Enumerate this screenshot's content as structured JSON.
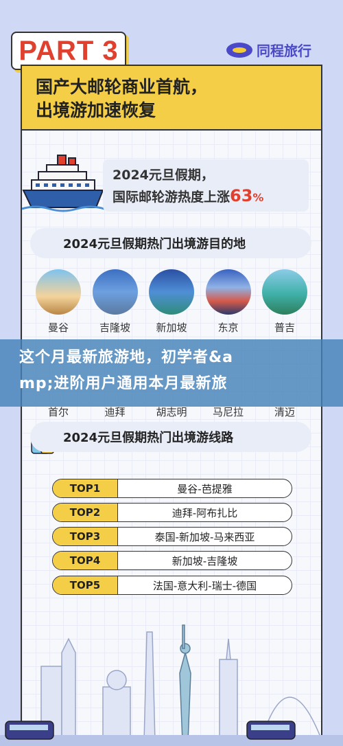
{
  "header": {
    "part_badge": "PART 3",
    "brand_name": "同程旅行",
    "title_line1": "国产大邮轮商业首航，",
    "title_line2": "出境游加速恢复"
  },
  "stat": {
    "line1": "2024元旦假期，",
    "line2_prefix": "国际邮轮游热度上涨",
    "percent_value": "63",
    "percent_sign": "%"
  },
  "destinations_section": {
    "title": "2024元旦假期热门出境游目的地",
    "row1": [
      "曼谷",
      "吉隆坡",
      "新加坡",
      "东京",
      "普吉"
    ],
    "row2": [
      "首尔",
      "迪拜",
      "胡志明",
      "马尼拉",
      "清迈"
    ]
  },
  "banner": {
    "line1": "这个月最新旅游地，初学者&a",
    "line2": "mp;进阶用户通用本月最新旅"
  },
  "routes_section": {
    "title": "2024元旦假期热门出境游线路",
    "routes": [
      {
        "rank": "TOP1",
        "route": "曼谷-芭提雅"
      },
      {
        "rank": "TOP2",
        "route": "迪拜-阿布扎比"
      },
      {
        "rank": "TOP3",
        "route": "泰国-新加坡-马来西亚"
      },
      {
        "rank": "TOP4",
        "route": "新加坡-吉隆坡"
      },
      {
        "rank": "TOP5",
        "route": "法国-意大利-瑞士-德国"
      }
    ]
  },
  "colors": {
    "accent_yellow": "#f4ce46",
    "accent_red": "#e0412f",
    "brand_purple": "#4b49c7",
    "banner_blue": "#4682b9",
    "background": "#cfd8f4"
  },
  "icons": [
    "brand-logo-icon",
    "cruise-ship-icon",
    "map-pin-icon",
    "luggage-icon"
  ]
}
